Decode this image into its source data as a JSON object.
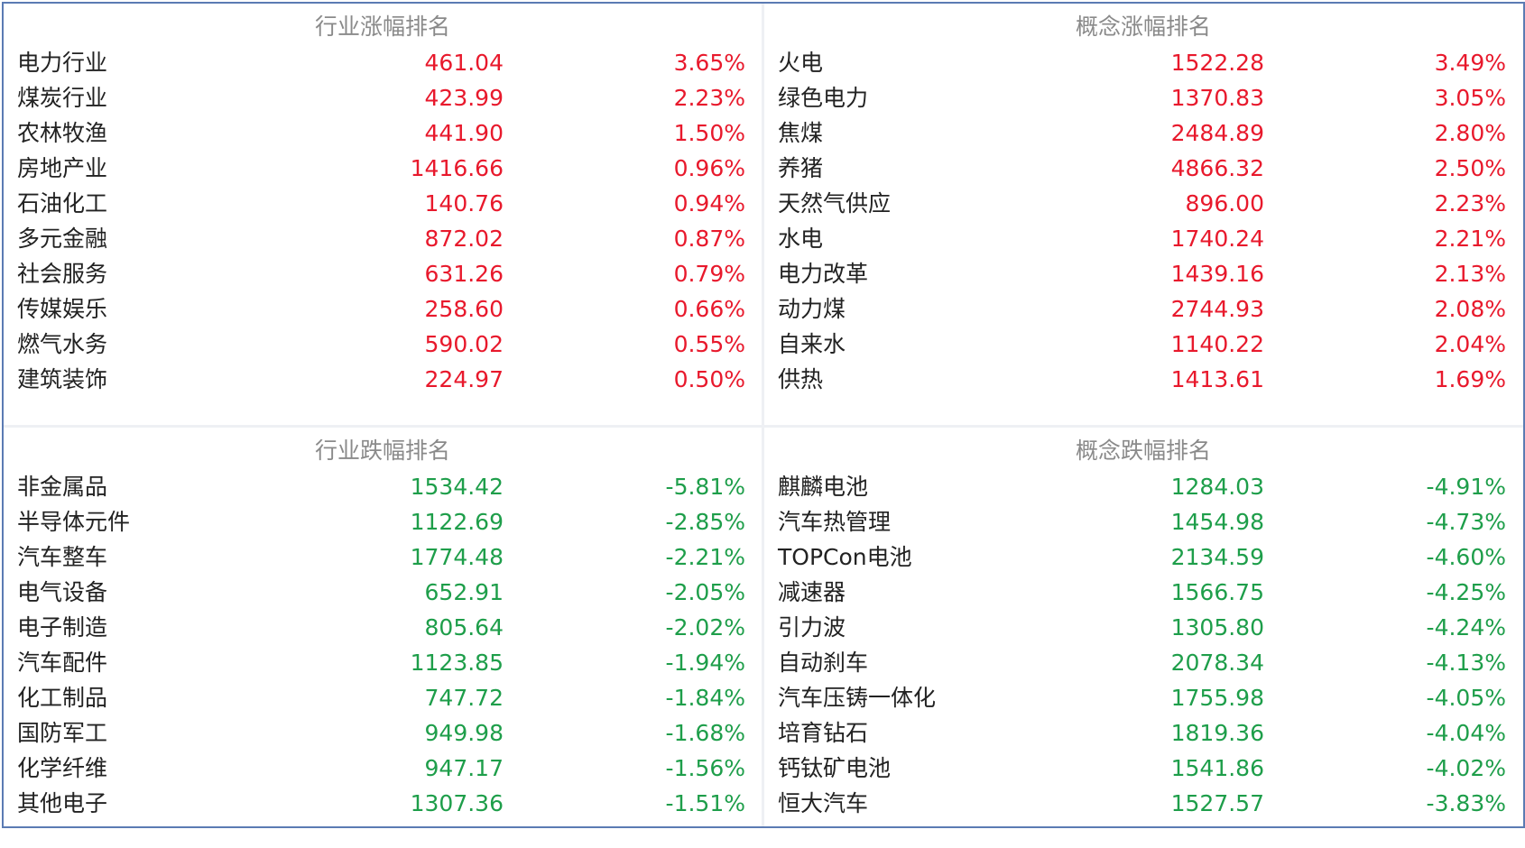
{
  "colors": {
    "up": "#e8192c",
    "down": "#1e9e4a",
    "title": "#8a8a8a",
    "frame_border": "#5b7bb3"
  },
  "panels": {
    "industry_up": {
      "title": "行业涨幅排名",
      "rows": [
        {
          "name": "电力行业",
          "value": "461.04",
          "pct": "3.65%"
        },
        {
          "name": "煤炭行业",
          "value": "423.99",
          "pct": "2.23%"
        },
        {
          "name": "农林牧渔",
          "value": "441.90",
          "pct": "1.50%"
        },
        {
          "name": "房地产业",
          "value": "1416.66",
          "pct": "0.96%"
        },
        {
          "name": "石油化工",
          "value": "140.76",
          "pct": "0.94%"
        },
        {
          "name": "多元金融",
          "value": "872.02",
          "pct": "0.87%"
        },
        {
          "name": "社会服务",
          "value": "631.26",
          "pct": "0.79%"
        },
        {
          "name": "传媒娱乐",
          "value": "258.60",
          "pct": "0.66%"
        },
        {
          "name": "燃气水务",
          "value": "590.02",
          "pct": "0.55%"
        },
        {
          "name": "建筑装饰",
          "value": "224.97",
          "pct": "0.50%"
        }
      ]
    },
    "concept_up": {
      "title": "概念涨幅排名",
      "rows": [
        {
          "name": "火电",
          "value": "1522.28",
          "pct": "3.49%"
        },
        {
          "name": "绿色电力",
          "value": "1370.83",
          "pct": "3.05%"
        },
        {
          "name": "焦煤",
          "value": "2484.89",
          "pct": "2.80%"
        },
        {
          "name": "养猪",
          "value": "4866.32",
          "pct": "2.50%"
        },
        {
          "name": "天然气供应",
          "value": "896.00",
          "pct": "2.23%"
        },
        {
          "name": "水电",
          "value": "1740.24",
          "pct": "2.21%"
        },
        {
          "name": "电力改革",
          "value": "1439.16",
          "pct": "2.13%"
        },
        {
          "name": "动力煤",
          "value": "2744.93",
          "pct": "2.08%"
        },
        {
          "name": "自来水",
          "value": "1140.22",
          "pct": "2.04%"
        },
        {
          "name": "供热",
          "value": "1413.61",
          "pct": "1.69%"
        }
      ]
    },
    "industry_down": {
      "title": "行业跌幅排名",
      "rows": [
        {
          "name": "非金属品",
          "value": "1534.42",
          "pct": "-5.81%"
        },
        {
          "name": "半导体元件",
          "value": "1122.69",
          "pct": "-2.85%"
        },
        {
          "name": "汽车整车",
          "value": "1774.48",
          "pct": "-2.21%"
        },
        {
          "name": "电气设备",
          "value": "652.91",
          "pct": "-2.05%"
        },
        {
          "name": "电子制造",
          "value": "805.64",
          "pct": "-2.02%"
        },
        {
          "name": "汽车配件",
          "value": "1123.85",
          "pct": "-1.94%"
        },
        {
          "name": "化工制品",
          "value": "747.72",
          "pct": "-1.84%"
        },
        {
          "name": "国防军工",
          "value": "949.98",
          "pct": "-1.68%"
        },
        {
          "name": "化学纤维",
          "value": "947.17",
          "pct": "-1.56%"
        },
        {
          "name": "其他电子",
          "value": "1307.36",
          "pct": "-1.51%"
        }
      ]
    },
    "concept_down": {
      "title": "概念跌幅排名",
      "rows": [
        {
          "name": "麒麟电池",
          "value": "1284.03",
          "pct": "-4.91%"
        },
        {
          "name": "汽车热管理",
          "value": "1454.98",
          "pct": "-4.73%"
        },
        {
          "name": "TOPCon电池",
          "value": "2134.59",
          "pct": "-4.60%"
        },
        {
          "name": "减速器",
          "value": "1566.75",
          "pct": "-4.25%"
        },
        {
          "name": "引力波",
          "value": "1305.80",
          "pct": "-4.24%"
        },
        {
          "name": "自动刹车",
          "value": "2078.34",
          "pct": "-4.13%"
        },
        {
          "name": "汽车压铸一体化",
          "value": "1755.98",
          "pct": "-4.05%"
        },
        {
          "name": "培育钻石",
          "value": "1819.36",
          "pct": "-4.04%"
        },
        {
          "name": "钙钛矿电池",
          "value": "1541.86",
          "pct": "-4.02%"
        },
        {
          "name": "恒大汽车",
          "value": "1527.57",
          "pct": "-3.83%"
        }
      ]
    }
  }
}
